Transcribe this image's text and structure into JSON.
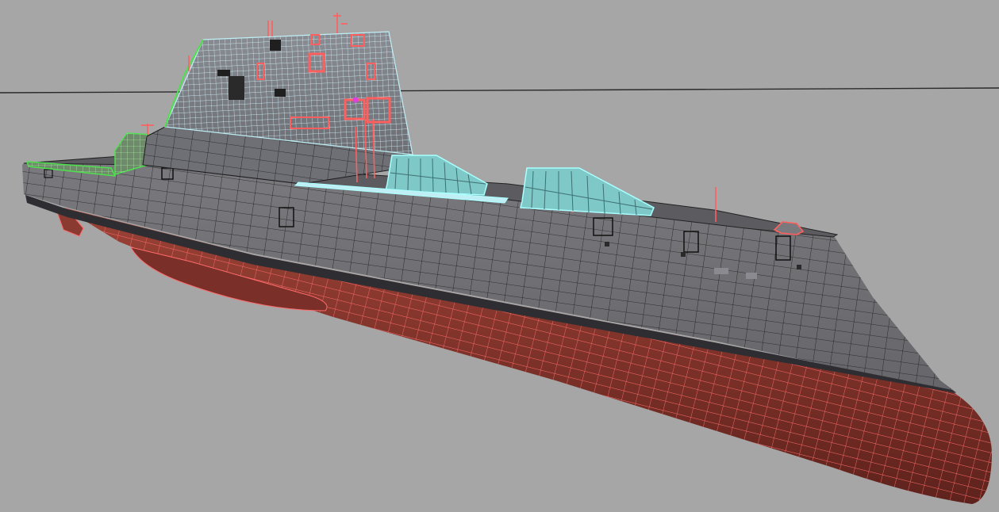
{
  "viewport": {
    "background": "#a6a6a6",
    "horizon_color": "#2a2a2a"
  },
  "model": {
    "parts": [
      {
        "name": "hull-upper-wireframe",
        "color": "#6e6e72",
        "wire": "#1c1c1c"
      },
      {
        "name": "hull-lower-wireframe",
        "color": "#8a3a30",
        "wire": "#ff6b6b"
      },
      {
        "name": "deckhouse-wireframe",
        "color": "#7e8088",
        "wire": "#bfeff5"
      },
      {
        "name": "selected-faces",
        "color": "#7ec8c8",
        "wire": "#aaffff"
      },
      {
        "name": "bow-deck-highlight",
        "color": "#6f8a6a",
        "wire": "#55e055"
      }
    ],
    "accent_colors": {
      "red_selection": "#ff5f5f",
      "cyan_selection": "#8ff5f5",
      "green_selection": "#4ee04e",
      "magenta_vertex": "#e040e0"
    }
  }
}
